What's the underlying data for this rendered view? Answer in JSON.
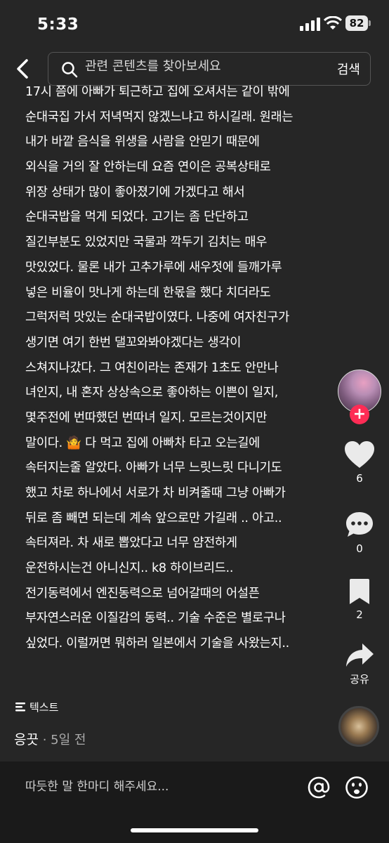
{
  "status_bar": {
    "time": "5:33",
    "battery": "82"
  },
  "search": {
    "placeholder": "관련 콘텐츠를 찾아보세요",
    "button_label": "검색"
  },
  "caption_lines": [
    "17시 쯤에 아빠가 퇴근하고 집에 오셔서는 같이 밖에",
    "순대국집 가서 저녁먹지 않겠느냐고 하시길래. 원래는",
    "내가 바깥 음식을 위생을 사람을 안믿기 때문에",
    "외식을 거의 잘 안하는데 요즘 연이은 공복상태로",
    "위장 상태가 많이 좋아졌기에 가겠다고 해서",
    "순대국밥을 먹게 되었다. 고기는 좀 단단하고",
    "질긴부분도 있었지만 국물과 깍두기 김치는 매우",
    "맛있었다. 물론 내가 고추가루에 새우젓에 들깨가루",
    "넣은 비율이 맛나게 하는데 한몫을 했다 치더라도",
    "그럭저럭 맛있는 순대국밥이였다. 나중에 여자친구가",
    "생기면 여기 한번 댈꼬와봐야겠다는 생각이",
    "스쳐지나갔다. 그 여친이라는 존재가 1초도 안만나",
    "녀인지, 내 혼자 상상속으로 좋아하는 이쁜이 일지,",
    "몇주전에 번따했던 번따녀 일지. 모르는것이지만",
    "말이다. 🤷 다 먹고 집에 아빠차 타고 오는길에",
    "속터지는줄 알았다. 아빠가 너무 느릿느릿 다니기도",
    "했고 차로 하나에서 서로가 차 비켜줄때 그냥 아빠가",
    "뒤로 좀 빼면 되는데 계속 앞으로만 가길래 .. 아고..",
    "속터져라. 차 새로 뽑았다고 너무 얌전하게",
    "운전하시는건 아니신지.. k8 하이브리드..",
    "전기동력에서 엔진동력으로 넘어갈때의 어설픈",
    "부자연스러운 이질감의 동력.. 기술 수준은 별로구나",
    "싶었다. 이럴꺼면 뭐하러 일본에서 기술을 사왔는지.."
  ],
  "side_rail": {
    "follow_symbol": "+",
    "likes": "6",
    "comments": "0",
    "bookmarks": "2",
    "share_label": "공유"
  },
  "post": {
    "type_label": "텍스트",
    "author": "응끗",
    "time_ago": " · 5일 전"
  },
  "comment_bar": {
    "placeholder": "따듯한 말 한마디 해주세요..."
  },
  "colors": {
    "background": "#262626",
    "accent": "#fe2c55",
    "comment_bar": "#1a1a1a"
  }
}
